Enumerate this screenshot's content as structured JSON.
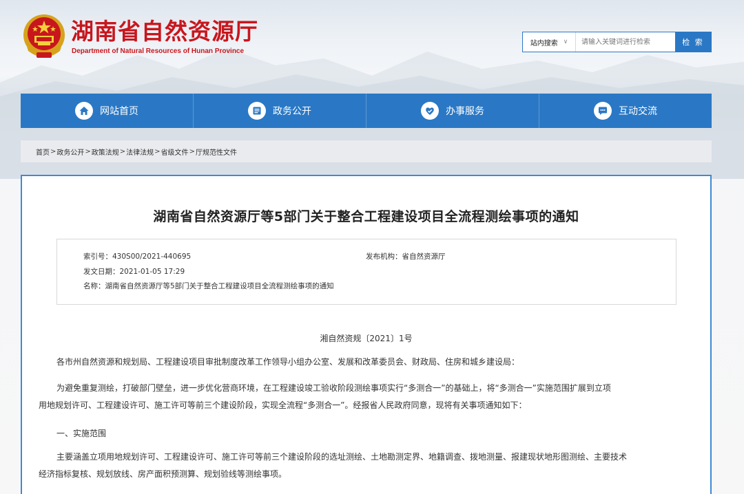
{
  "header": {
    "title_cn": "湖南省自然资源厅",
    "title_en": "Department of Natural Resources of Hunan Province",
    "logo_icon": "national-emblem-icon"
  },
  "search": {
    "scope_label": "站内搜索",
    "scope_chevron": "∨",
    "placeholder": "请输入关键词进行检索",
    "button_label": "检 索"
  },
  "nav": {
    "items": [
      {
        "label": "网站首页",
        "icon": "home-icon"
      },
      {
        "label": "政务公开",
        "icon": "document-list-icon"
      },
      {
        "label": "办事服务",
        "icon": "handshake-icon"
      },
      {
        "label": "互动交流",
        "icon": "chat-icon"
      }
    ]
  },
  "breadcrumb": {
    "items": [
      "首页",
      "政务公开",
      "政策法规",
      "法律法规",
      "省级文件",
      "厅规范性文件"
    ],
    "separator": ">"
  },
  "article": {
    "title": "湖南省自然资源厅等5部门关于整合工程建设项目全流程测绘事项的通知",
    "meta": {
      "index_label": "索引号：",
      "index_value": "430S00/2021-440695",
      "publisher_label": "发布机构：",
      "publisher_value": "省自然资源厅",
      "date_label": "发文日期：",
      "date_value": "2021-01-05 17:29",
      "name_label": "名称：",
      "name_value": "湖南省自然资源厅等5部门关于整合工程建设项目全流程测绘事项的通知"
    },
    "doc_number": "湘自然资规〔2021〕1号",
    "addressee": "各市州自然资源和规划局、工程建设项目审批制度改革工作领导小组办公室、发展和改革委员会、财政局、住房和城乡建设局：",
    "para1_line1": "为避免重复测绘，打破部门壁垒，进一步优化营商环境，在工程建设竣工验收阶段测绘事项实行“多测合一”的基础上，将“多测合一”实施范围扩展到立项",
    "para1_line2": "用地规划许可、工程建设许可、施工许可等前三个建设阶段，实现全流程“多测合一”。经报省人民政府同意，现将有关事项通知如下：",
    "section1_heading": "一、实施范围",
    "para2_line1": "主要涵盖立项用地规划许可、工程建设许可、施工许可等前三个建设阶段的选址测绘、土地勘测定界、地籍调查、拨地测量、报建现状地形图测绘、主要技术",
    "para2_line2": "经济指标复核、规划放线、房产面积预测算、规划验线等测绘事项。"
  },
  "colors": {
    "brand_red": "#c8161d",
    "nav_blue": "#2a78c5",
    "content_border": "#3c8ad3"
  }
}
